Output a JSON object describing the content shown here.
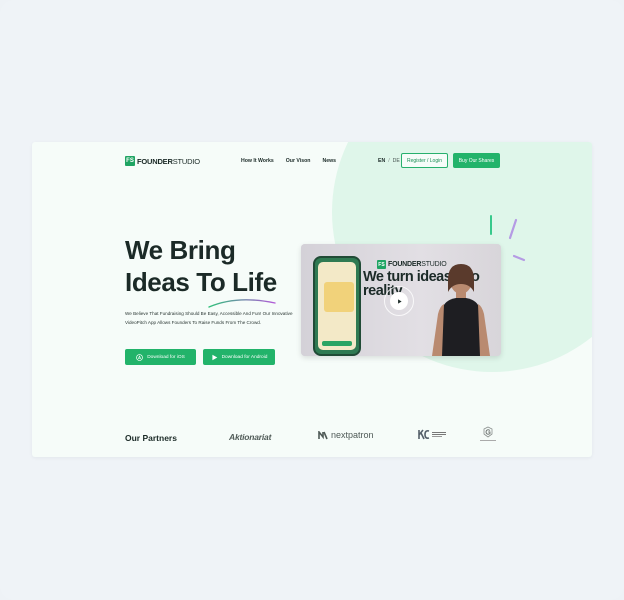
{
  "header": {
    "logo_mark": "FS",
    "logo_bold": "FOUNDER",
    "logo_light": "STUDIO",
    "nav": [
      "How It Works",
      "Our Vison",
      "News"
    ],
    "lang_active": "EN",
    "lang_sep": "/",
    "lang_other": "DE",
    "register_label": "Register / Login",
    "buy_label": "Buy Our Shares"
  },
  "hero": {
    "title_line1": "We Bring",
    "title_line2": "Ideas To Life",
    "description": "We Believe That Fundraising Should Be Easy, Accessible And Fun! Our Innovative VideoPitch App Allows Founders To Raise Funds From The Crowd.",
    "ios_label": "Download for iOS",
    "android_label": "Download for Android"
  },
  "video": {
    "logo_mark": "FS",
    "logo_bold": "FOUNDER",
    "logo_light": "STUDIO",
    "headline": "We turn ideas into reality"
  },
  "partners": {
    "title": "Our Partners",
    "names": [
      "Aktionariat",
      "nextpatron"
    ]
  },
  "colors": {
    "accent": "#22b36a",
    "text": "#1b2a27",
    "blob": "#dff6ea"
  }
}
